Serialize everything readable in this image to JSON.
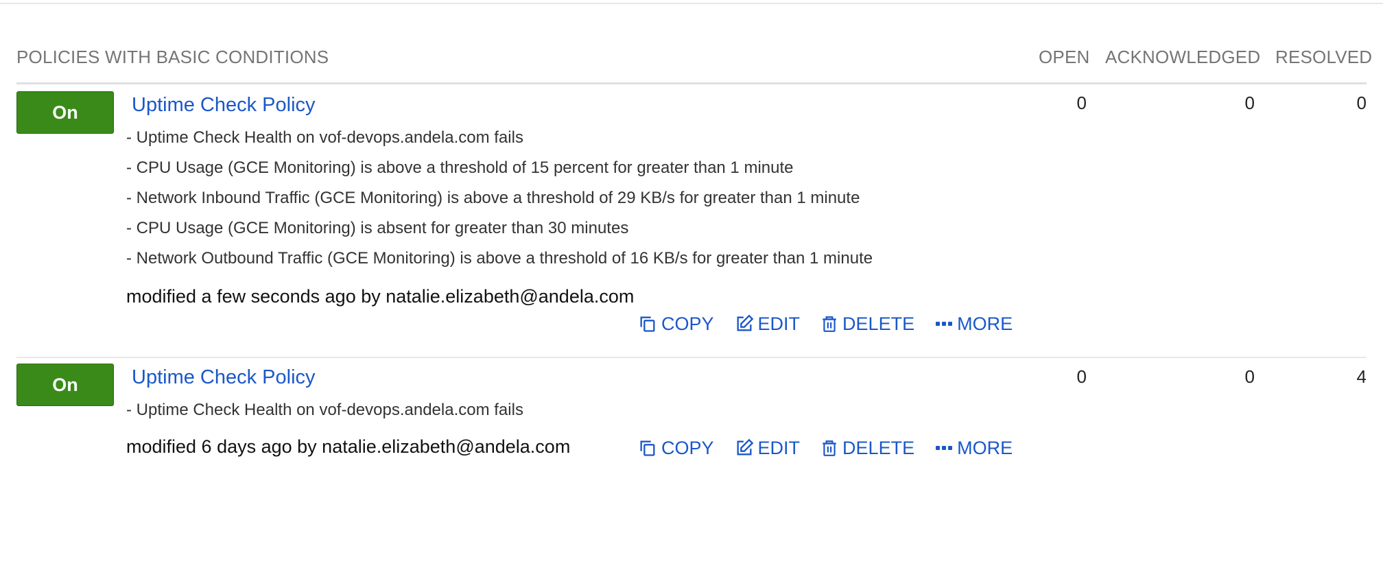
{
  "section": {
    "title": "POLICIES WITH BASIC CONDITIONS",
    "columns": {
      "open": "OPEN",
      "acknowledged": "ACKNOWLEDGED",
      "resolved": "RESOLVED"
    }
  },
  "policies": [
    {
      "toggle": "On",
      "name": "Uptime Check Policy",
      "conditions": [
        "- Uptime Check Health on vof-devops.andela.com fails",
        "- CPU Usage (GCE Monitoring) is above a threshold of 15 percent for greater than 1 minute",
        "- Network Inbound Traffic (GCE Monitoring) is above a threshold of 29 KB/s for greater than 1 minute",
        "- CPU Usage (GCE Monitoring) is absent for greater than 30 minutes",
        "- Network Outbound Traffic (GCE Monitoring) is above a threshold of 16 KB/s for greater than 1 minute"
      ],
      "modified": "modified a few seconds ago by natalie.elizabeth@andela.com",
      "open": "0",
      "acknowledged": "0",
      "resolved": "0"
    },
    {
      "toggle": "On",
      "name": "Uptime Check Policy",
      "conditions": [
        "- Uptime Check Health on vof-devops.andela.com fails"
      ],
      "modified": "modified 6 days ago by natalie.elizabeth@andela.com",
      "open": "0",
      "acknowledged": "0",
      "resolved": "4"
    }
  ],
  "actions": {
    "copy": "COPY",
    "edit": "EDIT",
    "delete": "DELETE",
    "more": "MORE"
  },
  "colors": {
    "toggle_on": "#3a8a1a",
    "link": "#1a57c9",
    "header_text": "#757575"
  },
  "icons": {
    "copy": "copy-icon",
    "edit": "edit-icon",
    "delete": "trash-icon",
    "more": "more-dots-icon"
  }
}
